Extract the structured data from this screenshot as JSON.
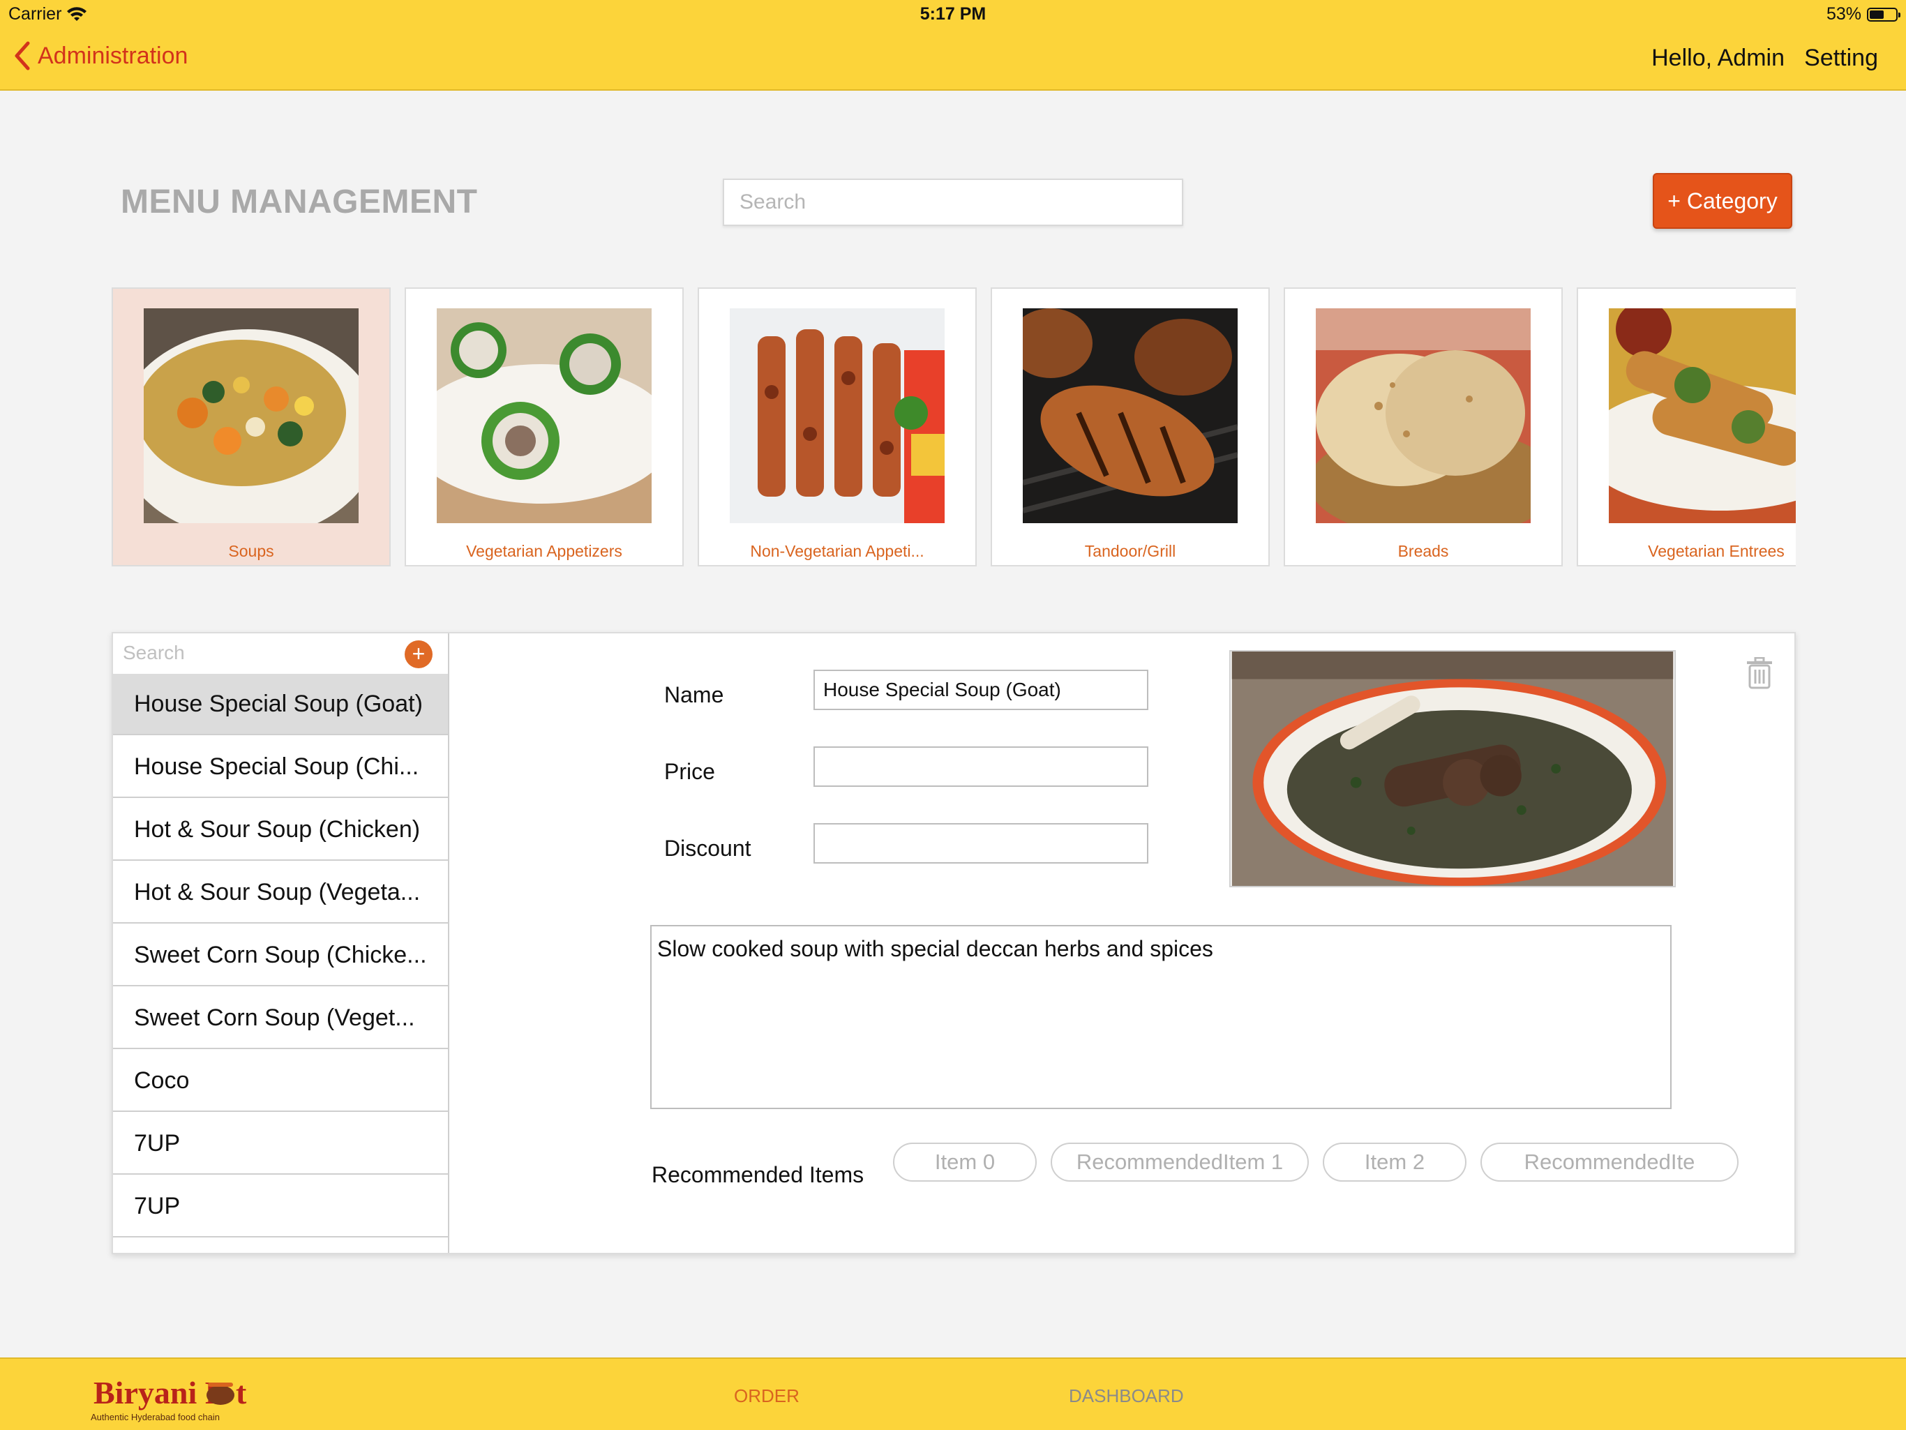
{
  "status_bar": {
    "carrier": "Carrier",
    "time": "5:17 PM",
    "battery": "53%"
  },
  "nav": {
    "back_label": "Administration",
    "greeting": "Hello, Admin",
    "setting_label": "Setting"
  },
  "header": {
    "title": "MENU MANAGEMENT",
    "search_placeholder": "Search",
    "add_category_label": "+ Category"
  },
  "categories": [
    {
      "label": "Soups",
      "selected": true
    },
    {
      "label": "Vegetarian Appetizers"
    },
    {
      "label": "Non-Vegetarian Appeti..."
    },
    {
      "label": "Tandoor/Grill"
    },
    {
      "label": "Breads"
    },
    {
      "label": "Vegetarian Entrees"
    }
  ],
  "item_list": {
    "search_placeholder": "Search",
    "add_label": "+",
    "items": [
      "House Special Soup (Goat)",
      "House Special Soup (Chi...",
      "Hot & Sour Soup (Chicken)",
      "Hot & Sour Soup (Vegeta...",
      "Sweet Corn Soup (Chicke...",
      "Sweet Corn Soup (Veget...",
      "Coco",
      "7UP",
      "7UP"
    ]
  },
  "detail": {
    "name_label": "Name",
    "name_value": "House Special Soup (Goat)",
    "price_label": "Price",
    "price_value": "",
    "discount_label": "Discount",
    "discount_value": "",
    "description": "Slow cooked soup with special deccan herbs and spices",
    "recommended_label": "Recommended Items",
    "recommended": [
      "Item 0",
      "RecommendedItem 1",
      "Item 2",
      "RecommendedIte"
    ]
  },
  "tabbar": {
    "logo_text": "Biryani Pot",
    "logo_tagline": "Authentic Hyderabad food chain",
    "tabs": [
      "ORDER",
      "DASHBOARD"
    ]
  },
  "colors": {
    "bar": "#fcd43a",
    "accent": "#e5541a",
    "category_text": "#d9641f",
    "back": "#d2331b"
  }
}
